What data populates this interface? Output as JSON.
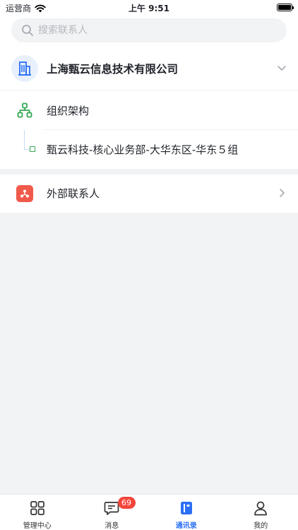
{
  "status_bar": {
    "carrier": "运营商",
    "time": "上午 9:51"
  },
  "search": {
    "placeholder": "搜索联系人"
  },
  "company": {
    "name": "上海甄云信息技术有限公司"
  },
  "org": {
    "label": "组织架构",
    "department": "甄云科技-核心业务部-大华东区-华东５组"
  },
  "external": {
    "label": "外部联系人"
  },
  "tabs": [
    {
      "label": "管理中心",
      "icon": "grid-icon"
    },
    {
      "label": "消息",
      "icon": "message-icon",
      "badge": "69"
    },
    {
      "label": "通讯录",
      "icon": "contacts-book-icon",
      "active": true
    },
    {
      "label": "我的",
      "icon": "user-icon"
    }
  ],
  "colors": {
    "accent": "#2b6ff5",
    "badge": "#f5453b",
    "org_green": "#34a853",
    "external_red": "#f05a4a"
  }
}
